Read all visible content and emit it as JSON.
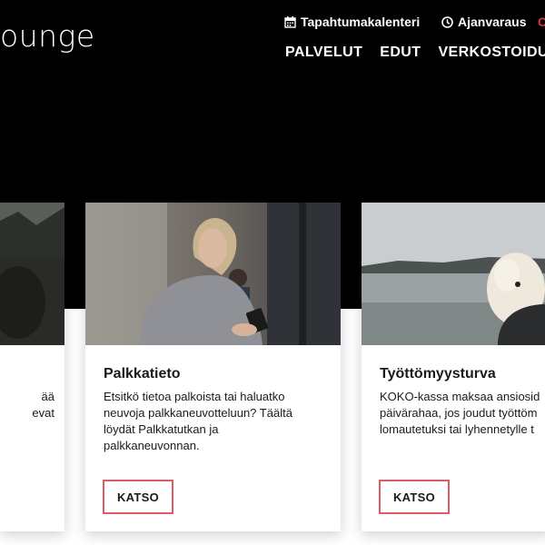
{
  "header": {
    "logo_text": "ounge",
    "utility_links": [
      {
        "label": "Tapahtumakalenteri",
        "icon": "calendar-icon"
      },
      {
        "label": "Ajanvaraus",
        "icon": "clock-icon"
      }
    ],
    "utility_cut_label": "C",
    "nav": [
      "PALVELUT",
      "EDUT",
      "VERKOSTOIDU"
    ]
  },
  "cards": [
    {
      "title": "",
      "text_fragments": [
        "ää",
        "evat"
      ],
      "photo": "person-outdoors-photo"
    },
    {
      "title": "Palkkatieto",
      "text": "Etsitkö tietoa palkoista tai haluatko neuvoja palkkaneuvotteluun? Täältä löydät Palkkatutkan ja palkkaneuvonnan.",
      "button_label": "KATSO",
      "photo": "woman-with-phone-photo"
    },
    {
      "title": "Työttömyysturva",
      "text": "KOKO-kassa maksaa ansiosid päivärahaa, jos joudut työttöm lomautetuksi tai lyhennetylle t",
      "button_label": "KATSO",
      "photo": "dog-by-lake-photo"
    }
  ],
  "colors": {
    "hero_bg": "#000000",
    "accent": "#e05a65",
    "cut_link": "#e0323c"
  }
}
